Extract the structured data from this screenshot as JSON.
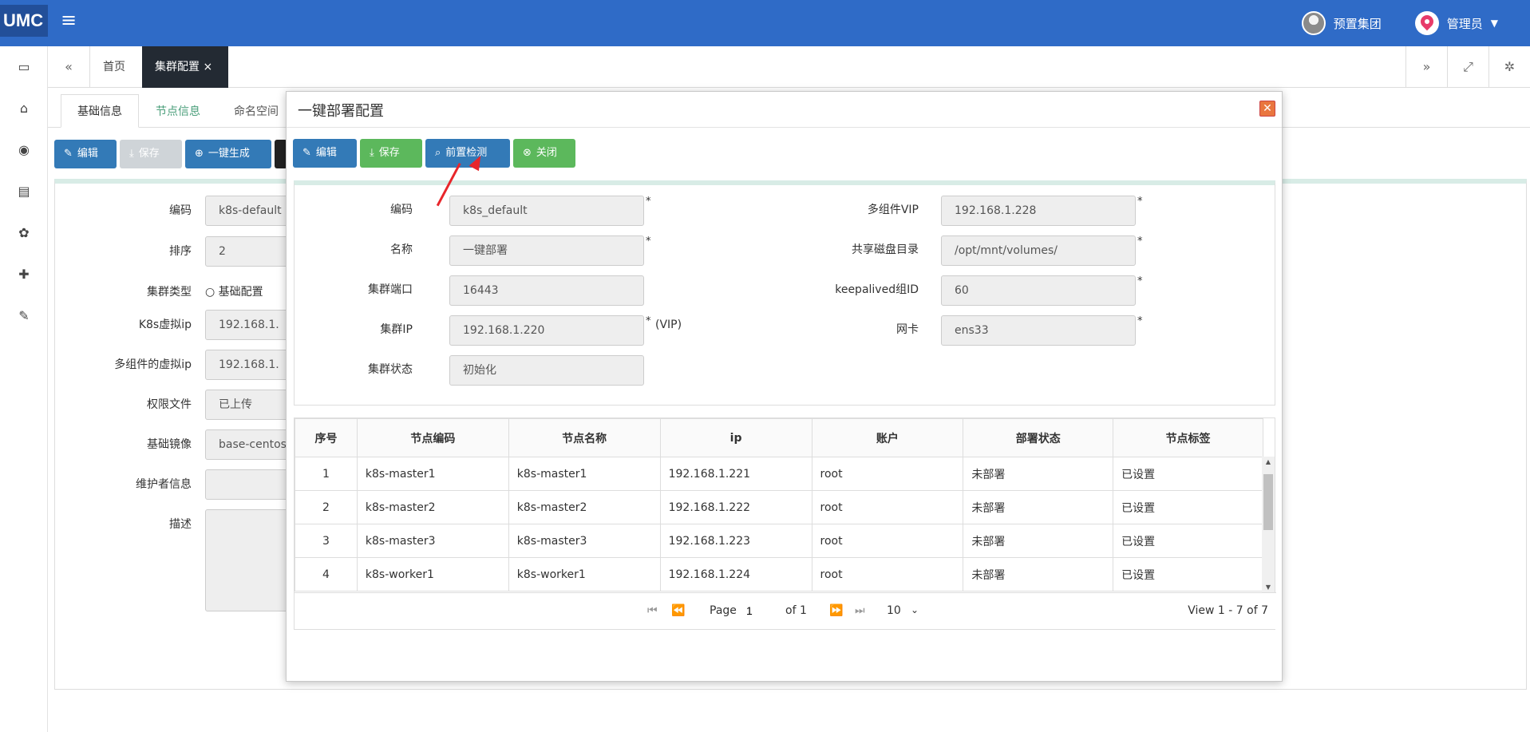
{
  "app": {
    "logo": "UMC",
    "menu_icon": "hamburger-icon"
  },
  "user": {
    "org": "预置集团",
    "role": "管理员"
  },
  "tabs": {
    "home": "首页",
    "active": "集群配置",
    "close": "×"
  },
  "subtabs": [
    "基础信息",
    "节点信息",
    "命名空间"
  ],
  "toolbar": {
    "edit": "编辑",
    "save": "保存",
    "generate": "一键生成"
  },
  "bg_form": {
    "code_label": "编码",
    "code_value": "k8s-default",
    "order_label": "排序",
    "order_value": "2",
    "type_label": "集群类型",
    "type_option": "基础配置",
    "vip_label": "K8s虚拟ip",
    "vip_value": "192.168.1.",
    "multi_vip_label": "多组件的虚拟ip",
    "multi_vip_value": "192.168.1.",
    "auth_label": "权限文件",
    "auth_value": "已上传",
    "image_label": "基础镜像",
    "image_value": "base-centos",
    "maint_label": "维护者信息",
    "maint_value": "",
    "desc_label": "描述",
    "desc_value": ""
  },
  "dialog": {
    "title": "一键部署配置",
    "buttons": {
      "edit": "编辑",
      "save": "保存",
      "precheck": "前置检测",
      "close": "关闭"
    },
    "form": {
      "code_label": "编码",
      "code_value": "k8s_default",
      "name_label": "名称",
      "name_value": "一键部署",
      "port_label": "集群端口",
      "port_value": "16443",
      "ip_label": "集群IP",
      "ip_value": "192.168.1.220",
      "ip_note": "(VIP)",
      "state_label": "集群状态",
      "state_value": "初始化",
      "mvip_label": "多组件VIP",
      "mvip_value": "192.168.1.228",
      "disk_label": "共享磁盘目录",
      "disk_value": "/opt/mnt/volumes/",
      "kp_label": "keepalived组ID",
      "kp_value": "60",
      "nic_label": "网卡",
      "nic_value": "ens33",
      "required": "*"
    },
    "table": {
      "headers": [
        "序号",
        "节点编码",
        "节点名称",
        "ip",
        "账户",
        "部署状态",
        "节点标签"
      ],
      "rows": [
        [
          "1",
          "k8s-master1",
          "k8s-master1",
          "192.168.1.221",
          "root",
          "未部署",
          "已设置"
        ],
        [
          "2",
          "k8s-master2",
          "k8s-master2",
          "192.168.1.222",
          "root",
          "未部署",
          "已设置"
        ],
        [
          "3",
          "k8s-master3",
          "k8s-master3",
          "192.168.1.223",
          "root",
          "未部署",
          "已设置"
        ],
        [
          "4",
          "k8s-worker1",
          "k8s-worker1",
          "192.168.1.224",
          "root",
          "未部署",
          "已设置"
        ]
      ]
    },
    "pager": {
      "page_label": "Page",
      "page_value": "1",
      "of_label": "of 1",
      "size": "10",
      "view": "View 1 - 7 of 7"
    }
  }
}
